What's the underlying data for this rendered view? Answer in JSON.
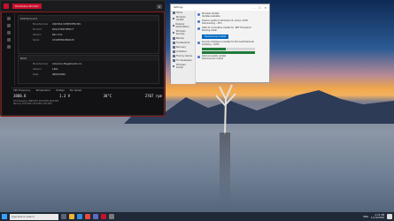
{
  "hwinfo": {
    "tab_label": "Hardware Monitor",
    "close": "x",
    "section1_title": "Motherboard",
    "section1_rows": [
      {
        "k": "Manufacturer",
        "v": "ASUSTeK COMPUTER INC."
      },
      {
        "k": "Product",
        "v": "ROG STRIX B550-F"
      },
      {
        "k": "Version",
        "v": "Rev X.0x"
      },
      {
        "k": "Serial",
        "v": "191055822600123"
      }
    ],
    "section2_title": "BIOS",
    "section2_rows": [
      {
        "k": "Manufacturer",
        "v": "American Megatrends Inc."
      },
      {
        "k": "Version",
        "v": "1401"
      },
      {
        "k": "Date",
        "v": "08/05/2020"
      }
    ],
    "monitor_tabs": [
      "CPU Frequency",
      "Temperature",
      "Voltage",
      "Fan Speed"
    ],
    "monitor_stats": [
      "3888.8",
      "1.3 V",
      "38°C",
      "2707 rpm"
    ],
    "monitor_rows": [
      "CPU Frequency  3888 MHz  3810 MHz  4049 MHz",
      "Memory  1333 MHz  1333 MHz  1333 MHz"
    ]
  },
  "settings": {
    "title": "Settings",
    "controls": [
      "–",
      "☐",
      "✕"
    ],
    "nav": [
      "Home",
      "Windows Update",
      "Delivery Optimization",
      "Windows Security",
      "Backup",
      "Troubleshoot",
      "Recovery",
      "Activation",
      "Find my device",
      "For developers",
      "Windows Insider"
    ],
    "updates": [
      {
        "title": "Windows Update",
        "desc": "Updates available"
      },
      {
        "title": "Feature update to Windows 10, version 20H2",
        "desc": "Downloading – 45%"
      },
      {
        "title": "2020-11 Cumulative Update for .NET Framework",
        "desc": "Pending install"
      },
      {
        "title": "Security Intelligence Update for Microsoft Defender",
        "desc": "Installing – 100%"
      },
      {
        "title": "Optional quality update",
        "desc": "Download and install"
      }
    ],
    "button_label": "Download and install",
    "progress1": 0.45,
    "progress2": 1.0
  },
  "taskbar": {
    "search_placeholder": "Type here to search",
    "tray_time": "4:21 PM",
    "tray_date": "11/12/2020",
    "lang": "ENG"
  }
}
